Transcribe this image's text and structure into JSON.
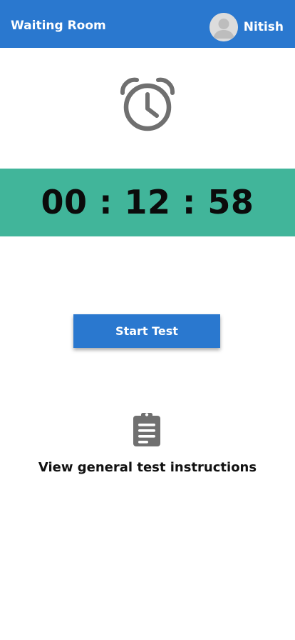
{
  "header": {
    "title": "Waiting Room",
    "user_name": "Nitish",
    "avatar_icon": "user-avatar-icon",
    "background_color": "#2a78cf"
  },
  "countdown": {
    "icon": "alarm-clock-icon",
    "time": "00 : 12 : 58",
    "band_color": "#41b59a"
  },
  "actions": {
    "start_label": "Start Test",
    "instructions_icon": "clipboard-list-icon",
    "instructions_label": "View general test instructions"
  }
}
